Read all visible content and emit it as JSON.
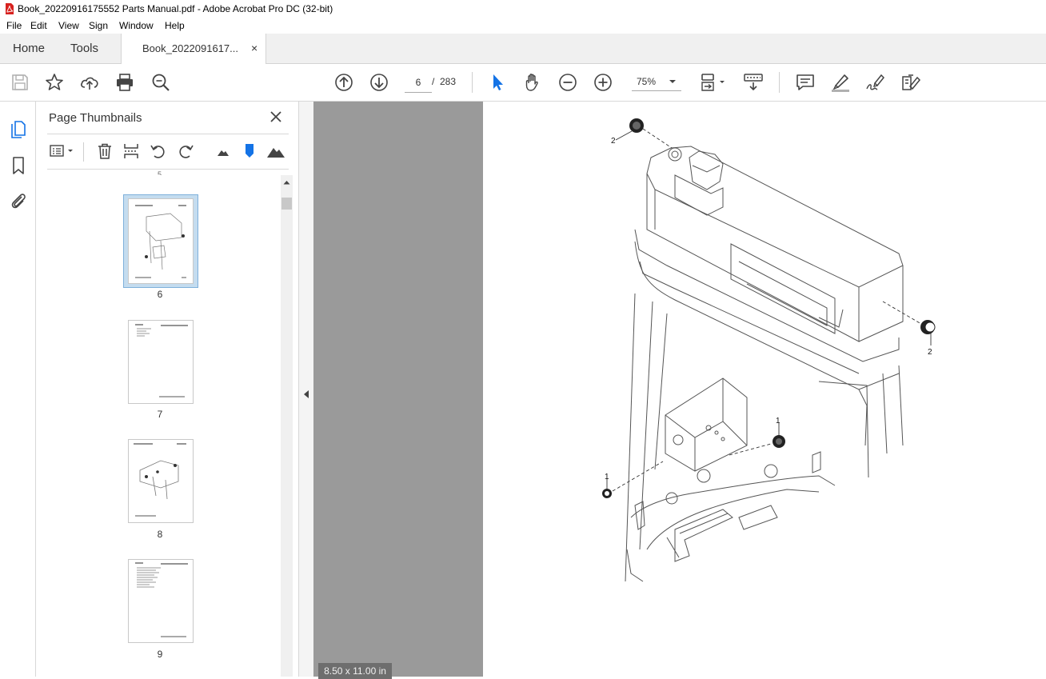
{
  "window": {
    "title": "Book_20220916175552 Parts Manual.pdf - Adobe Acrobat Pro DC (32-bit)"
  },
  "menu": [
    "File",
    "Edit",
    "View",
    "Sign",
    "Window",
    "Help"
  ],
  "tabs": {
    "home": "Home",
    "tools": "Tools",
    "document": "Book_2022091617...",
    "close": "×"
  },
  "toolbar": {
    "current_page": "6",
    "page_separator": "/",
    "total_pages": "283",
    "zoom": "75%"
  },
  "thumbnails": {
    "title": "Page Thumbnails",
    "pages": [
      {
        "number": "6",
        "selected": true
      },
      {
        "number": "7",
        "selected": false
      },
      {
        "number": "8",
        "selected": false
      },
      {
        "number": "9",
        "selected": false
      }
    ]
  },
  "document": {
    "page_size": "8.50 x 11.00 in",
    "callouts": [
      "2",
      "2",
      "1",
      "1"
    ]
  },
  "colors": {
    "accent": "#1473e6",
    "pdf_red": "#d7221f",
    "selected_thumb": "#c4dcef"
  }
}
